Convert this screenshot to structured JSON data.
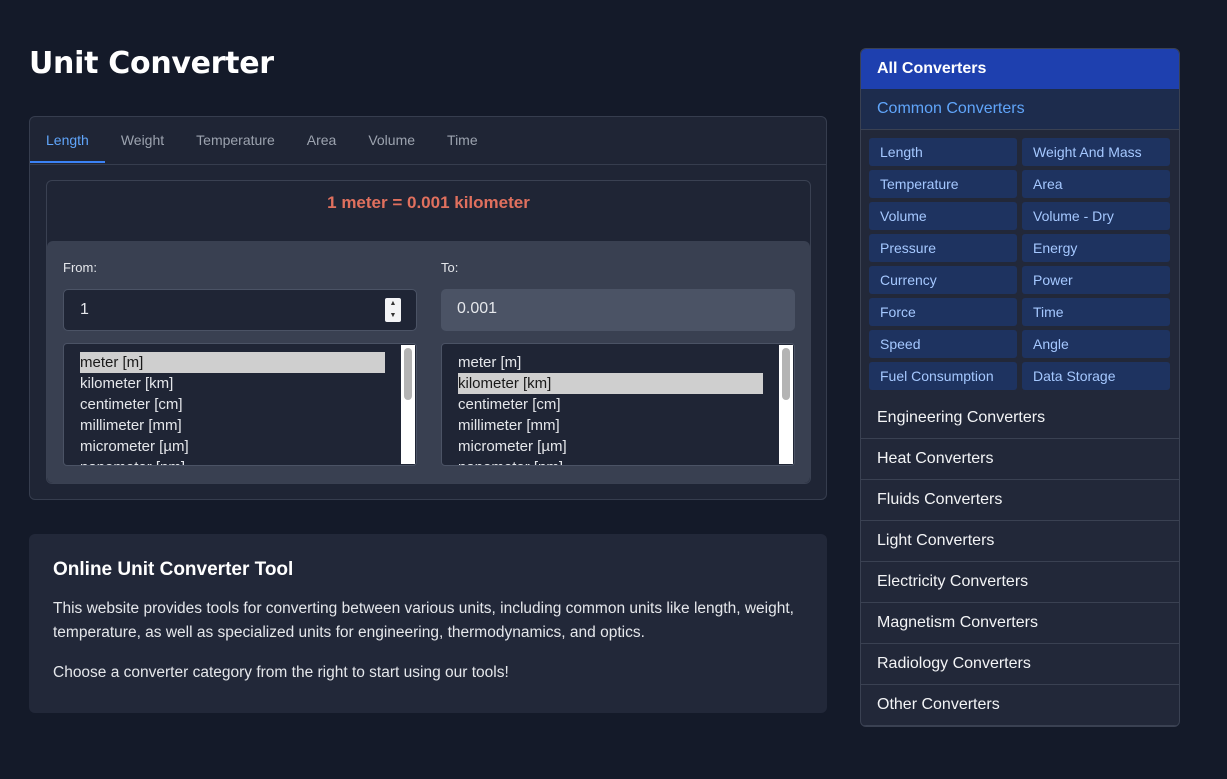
{
  "page_title": "Unit Converter",
  "tabs": [
    {
      "label": "Length"
    },
    {
      "label": "Weight"
    },
    {
      "label": "Temperature"
    },
    {
      "label": "Area"
    },
    {
      "label": "Volume"
    },
    {
      "label": "Time"
    }
  ],
  "active_tab": "Length",
  "result_text": "1 meter = 0.001 kilometer",
  "from": {
    "label": "From:",
    "value": "1",
    "units": [
      "meter [m]",
      "kilometer [km]",
      "centimeter [cm]",
      "millimeter [mm]",
      "micrometer [µm]",
      "nanometer [nm]"
    ],
    "selected": "meter [m]"
  },
  "to": {
    "label": "To:",
    "value": "0.001",
    "units": [
      "meter [m]",
      "kilometer [km]",
      "centimeter [cm]",
      "millimeter [mm]",
      "micrometer [µm]",
      "nanometer [nm]"
    ],
    "selected": "kilometer [km]"
  },
  "info": {
    "title": "Online Unit Converter Tool",
    "paragraph1": "This website provides tools for converting between various units, including common units like length, weight, temperature, as well as specialized units for engineering, thermodynamics, and optics.",
    "paragraph2": "Choose a converter category from the right to start using our tools!"
  },
  "sidebar": {
    "all_label": "All Converters",
    "common_label": "Common Converters",
    "common_items": [
      "Length",
      "Weight And Mass",
      "Temperature",
      "Area",
      "Volume",
      "Volume - Dry",
      "Pressure",
      "Energy",
      "Currency",
      "Power",
      "Force",
      "Time",
      "Speed",
      "Angle",
      "Fuel Consumption",
      "Data Storage"
    ],
    "categories": [
      "Engineering Converters",
      "Heat Converters",
      "Fluids Converters",
      "Light Converters",
      "Electricity Converters",
      "Magnetism Converters",
      "Radiology Converters",
      "Other Converters"
    ]
  },
  "colors": {
    "background": "#141a29",
    "accent": "#3b82f6",
    "result": "#e0705e",
    "sidebar_active": "#1e40af"
  }
}
